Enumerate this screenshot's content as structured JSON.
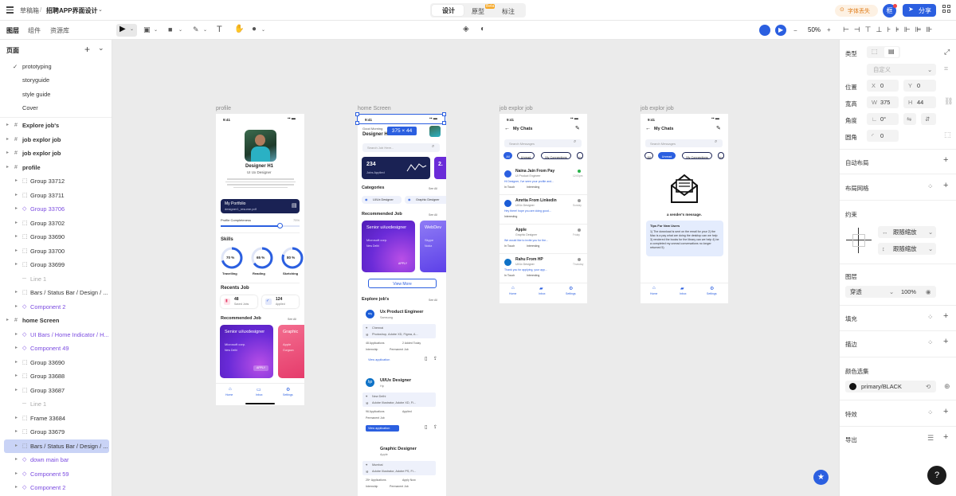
{
  "topbar": {
    "menu_icon": "hamburger-icon",
    "breadcrumb_root": "草稿箱",
    "separator": "/",
    "file_title": "招聘APP界面设计",
    "tabs": [
      "设计",
      "原型",
      "标注"
    ],
    "beta_badge": "Beta",
    "font_missing": "字体丢失",
    "avatar_text": "框",
    "share_label": "分享"
  },
  "toolbar": {
    "zoom": "50%"
  },
  "left_panel": {
    "tabs": [
      "图层",
      "组件",
      "资源库"
    ],
    "pages_title": "页面",
    "pages": [
      "prototyping",
      "storyguide",
      "style guide",
      "Cover"
    ],
    "layers": [
      {
        "label": "Explore job's",
        "level": 0
      },
      {
        "label": "job explor job",
        "level": 0
      },
      {
        "label": "job explor job",
        "level": 0
      },
      {
        "label": "profile",
        "level": 0
      },
      {
        "label": "Group 33712",
        "level": 1
      },
      {
        "label": "Group 33711",
        "level": 1
      },
      {
        "label": "Group 33706",
        "level": 1,
        "style": "purple"
      },
      {
        "label": "Group 33702",
        "level": 1
      },
      {
        "label": "Group 33690",
        "level": 1
      },
      {
        "label": "Group 33700",
        "level": 1
      },
      {
        "label": "Group 33699",
        "level": 1
      },
      {
        "label": "Line 1",
        "level": 1,
        "style": "muted"
      },
      {
        "label": "Bars / Status Bar / Design / ...",
        "level": 1
      },
      {
        "label": "Component 2",
        "level": 1,
        "style": "purple"
      },
      {
        "label": "home Screen",
        "level": 0
      },
      {
        "label": "UI Bars / Home Indicator / H...",
        "level": 1,
        "style": "purple"
      },
      {
        "label": "Component 49",
        "level": 1,
        "style": "purple"
      },
      {
        "label": "Group 33690",
        "level": 1
      },
      {
        "label": "Group 33688",
        "level": 1
      },
      {
        "label": "Group 33687",
        "level": 1
      },
      {
        "label": "Line 1",
        "level": 1,
        "style": "muted"
      },
      {
        "label": "Frame 33684",
        "level": 1
      },
      {
        "label": "Group 33679",
        "level": 1
      },
      {
        "label": "Bars / Status Bar / Design / ...",
        "level": 1,
        "style": "selected"
      },
      {
        "label": "down main bar",
        "level": 1,
        "style": "purple"
      },
      {
        "label": "Component 59",
        "level": 1,
        "style": "purple"
      },
      {
        "label": "Component 2",
        "level": 1,
        "style": "purple"
      }
    ]
  },
  "canvas": {
    "frame_labels": [
      "profile",
      "home Screen",
      "job explor job",
      "job explor job"
    ],
    "size_badge": "375 × 44",
    "profile": {
      "time": "9:41",
      "name": "Designer H1",
      "role": "UI Ux Designer",
      "portfolio_title": "My Portfolio",
      "portfolio_file": "designer1_resume.pdf",
      "completeness_label": "Profile Completeness",
      "completeness_value": "75%",
      "completeness_fraction": 0.75,
      "skills_title": "Skills",
      "skills": [
        {
          "pct": "70 %",
          "label": "Travelling",
          "value": 0.7
        },
        {
          "pct": "65 %",
          "label": "Reading",
          "value": 0.65
        },
        {
          "pct": "80 %",
          "label": "Sketching",
          "value": 0.8
        }
      ],
      "recents_title": "Recents Job",
      "recent1_num": "48",
      "recent1_text": "Saved Jobs",
      "recent2_num": "124",
      "recent2_text": "Applied",
      "recommended_title": "Recommended Job",
      "see_all": "See All",
      "rec_card_title": "Senior ui/uxdesigner",
      "rec_card_company": "Microsoft corp.",
      "rec_card_location": "New Delhi",
      "rec_card_button": "APPLY",
      "rec_card2_title": "Graphic",
      "rec_card2_company": "Apple",
      "rec_card2_location": "Gurgaon",
      "nav": [
        "Home",
        "Inbox",
        "Settings"
      ]
    },
    "home": {
      "time": "9:41",
      "greeting": "Good Morning",
      "title": "Designer H1",
      "search": "Search Job Here...",
      "stat_num": "234",
      "stat_text": "Jobs Applied",
      "categories_title": "Categories",
      "see_all": "See All",
      "categories": [
        "UI/Ux Designer",
        "Graphic Designer"
      ],
      "recommended_title": "Recommended Job",
      "rec_title": "Senior ui/uxdesigner",
      "rec_company": "Microsoft corp.",
      "rec_location": "New Delhi",
      "rec_button": "APPLY",
      "rec2_title": "WebDev",
      "rec2_company": "Skype",
      "rec2_location": "Noida",
      "view_more": "View More",
      "explore_title": "Explore job's",
      "jobs": [
        {
          "title": "Ux Product Engineer",
          "company": "Samsung",
          "location": "Chennai",
          "skills": "Photoshop, Adobe XD, Figma, A...",
          "applications": "48 Applications",
          "posted": "2 Added Today",
          "tag1": "Internship",
          "tag2": "Permanent Job",
          "button": "View application"
        },
        {
          "title": "UI/Ux Designer",
          "company": "Hp",
          "location": "New Delhi",
          "skills": "Adobe Illustrator, Adobe XD, Fi...",
          "applications": "96 Applications",
          "posted": "Applied",
          "tag1": "Permanent Job",
          "tag2": "",
          "button": "View application"
        },
        {
          "title": "Graphic Designer",
          "company": "Apple",
          "location": "Mumbai",
          "skills": "Adobe Illustrator, Adobe PS, Fi...",
          "applications": "25+ Applications",
          "posted": "Apply Now",
          "tag1": "Internship",
          "tag2": "Permanent Job",
          "button": ""
        }
      ]
    },
    "chats1": {
      "time": "9:41",
      "title": "My Chats",
      "search": "Search Messages",
      "filters": [
        "All",
        "Unread",
        "My Connections",
        "In"
      ],
      "items": [
        {
          "name": "Naina Jain From Pay",
          "sub": "UI Product Engineer",
          "msg": "Hi Designer, I've seen your profile and...",
          "tag1": "In Touch",
          "tag2": "Interesting",
          "time": "12:00pm"
        },
        {
          "name": "Amrita From Linkedin",
          "sub": "UI/Ux Designer",
          "msg": "Hey there! hope you are doing good...",
          "tag1": "Interesting",
          "tag2": "",
          "time": "Sunday"
        },
        {
          "name": "Apple",
          "sub": "Graphic Designer",
          "msg": "We would like to invite you for the...",
          "tag1": "In Touch",
          "tag2": "Interesting",
          "time": "Friday"
        },
        {
          "name": "Rahu From HP",
          "sub": "UI/Ux Designer",
          "msg": "Thank you for applying, your app...",
          "tag1": "In Touch",
          "tag2": "Interesting",
          "time": "Thursday"
        }
      ],
      "nav": [
        "Home",
        "Inbox",
        "Settings"
      ]
    },
    "chats2": {
      "time": "9:41",
      "title": "My Chats",
      "search": "Search Messages",
      "filters": [
        "All",
        "Unread",
        "My Connections",
        "In"
      ],
      "caption": "a sender's message.",
      "msg_title": "Tips For New Users",
      "msg_body": "1) The download is sent on the email for your 2) the Mac is a pay what are doing the desktop can we help 3) rendered the books for the library can we help 4) be a completed my unread conversations no longer returned 5)",
      "nav": [
        "Home",
        "Inbox",
        "Settings"
      ]
    }
  },
  "right_panel": {
    "type_label": "类型",
    "preset": "自定义",
    "position_label": "位置",
    "x_label": "X",
    "x_value": "0",
    "y_label": "Y",
    "y_value": "0",
    "size_label": "宽高",
    "w_label": "W",
    "w_value": "375",
    "h_label": "H",
    "h_value": "44",
    "angle_label": "角度",
    "angle_value": "0°",
    "radius_label": "圆角",
    "radius_value": "0",
    "auto_layout": "自动布局",
    "layout_grid": "布局网格",
    "constraints": "约束",
    "h_constraint": "跟随缩放",
    "v_constraint": "跟随缩放",
    "layer_title": "图层",
    "blend": "穿透",
    "opacity": "100%",
    "fill": "填充",
    "stroke": "描边",
    "color_select": "颜色选集",
    "color_name": "primary/BLACK",
    "effects": "特效",
    "export": "导出"
  },
  "colors": {
    "accent": "#1f5eea",
    "purple": "#7b4be0",
    "canvas_bg": "#ebebeb",
    "card_purple": "#6a2bd8",
    "card_pink": "#f0517a",
    "dark_navy": "#1a2254"
  },
  "help_label": "?"
}
